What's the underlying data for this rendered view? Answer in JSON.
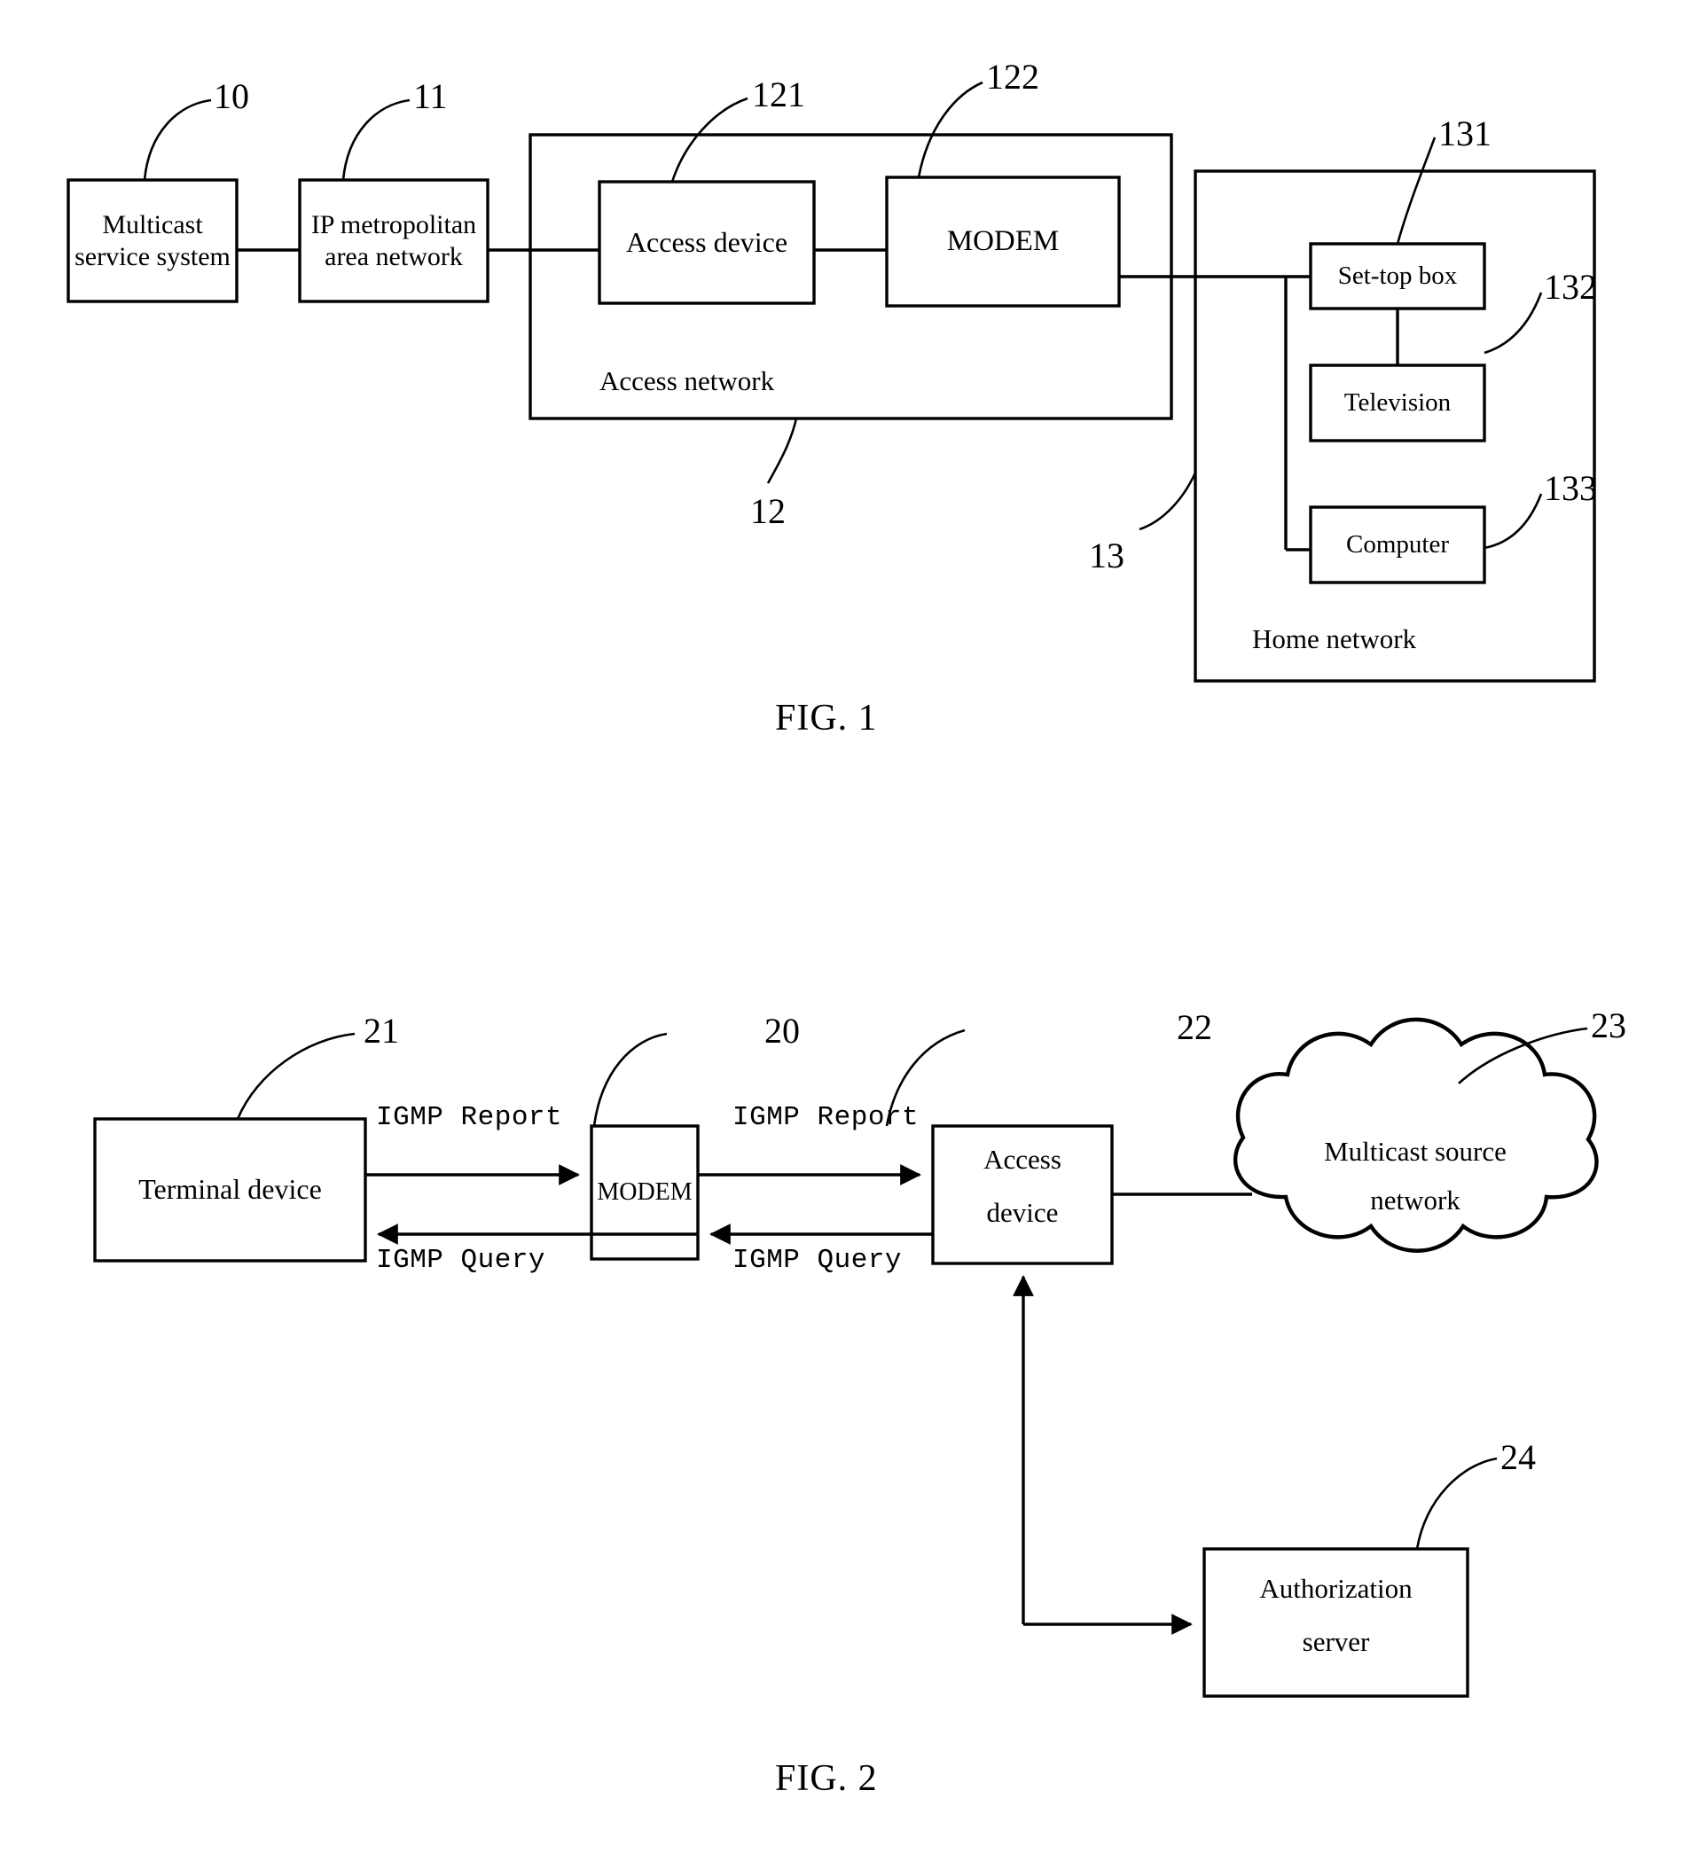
{
  "figures": [
    {
      "caption": "FIG. 1",
      "nodes": {
        "multicast_service_system": "Multicast service system",
        "ip_metropolitan_area_network": "IP metropolitan area network",
        "access_device": "Access device",
        "modem": "MODEM",
        "set_top_box": "Set-top box",
        "television": "Television",
        "computer": "Computer"
      },
      "zones": {
        "access_network": "Access network",
        "home_network": "Home network"
      },
      "refs": {
        "multicast_service_system": "10",
        "ip_metropolitan_area_network": "11",
        "access_network": "12",
        "access_device": "121",
        "modem": "122",
        "home_network": "13",
        "set_top_box": "131",
        "television": "132",
        "computer": "133"
      }
    },
    {
      "caption": "FIG. 2",
      "nodes": {
        "terminal_device": "Terminal device",
        "modem": "MODEM",
        "access_device_line1": "Access",
        "access_device_line2": "device",
        "multicast_source_network_line1": "Multicast source",
        "multicast_source_network_line2": "network",
        "authorization_server_line1": "Authorization",
        "authorization_server_line2": "server"
      },
      "flows": {
        "igmp_report_left": "IGMP Report",
        "igmp_query_left": "IGMP Query",
        "igmp_report_right": "IGMP Report",
        "igmp_query_right": "IGMP Query"
      },
      "refs": {
        "modem": "20",
        "terminal_device": "21",
        "access_device": "22",
        "multicast_source_network": "23",
        "authorization_server": "24"
      }
    }
  ],
  "colors": {
    "ink": "#000000",
    "paper": "#ffffff"
  }
}
